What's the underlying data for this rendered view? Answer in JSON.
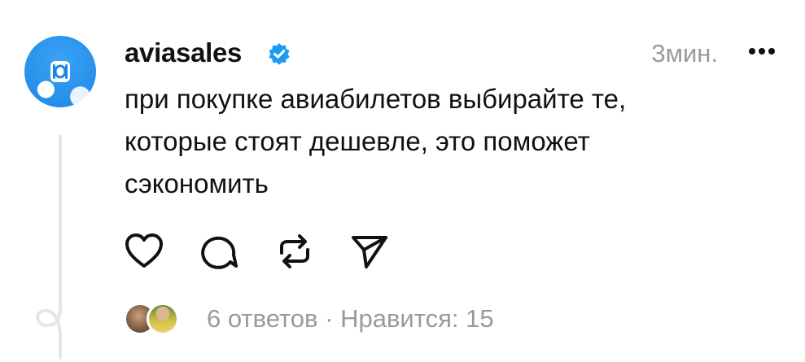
{
  "post": {
    "username": "aviasales",
    "verified": true,
    "time": "3мин.",
    "text": "при покупке авиабилетов выбирайте те,\nкоторые стоят дешевле, это поможет\nсэкономить",
    "actions": [
      "heart-icon",
      "comment-icon",
      "repost-icon",
      "share-icon"
    ],
    "replies": "6 ответов",
    "separator": "·",
    "likes": "Нравится: 15"
  },
  "colors": {
    "verified": "#1d9bf0",
    "avatar": "#1c86e6",
    "muted": "#9a9a9a",
    "text": "#111111"
  }
}
